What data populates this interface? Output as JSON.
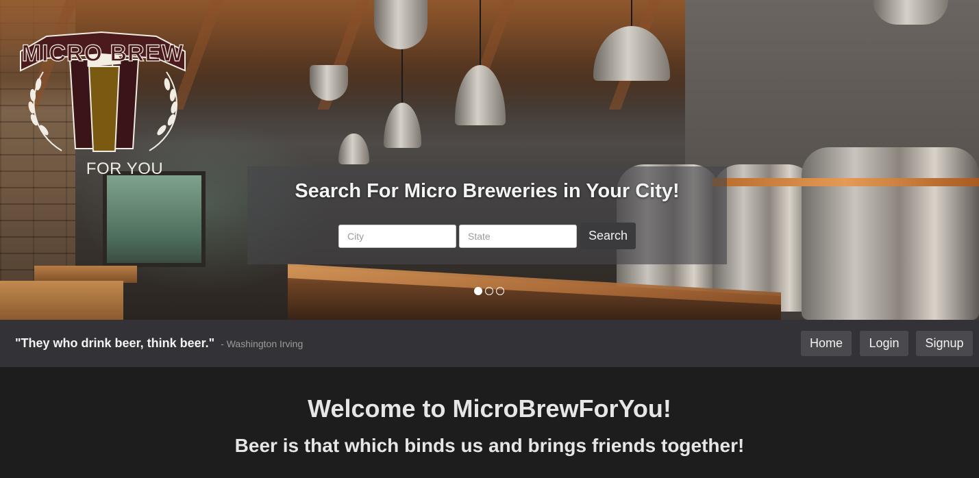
{
  "logo": {
    "main_text": "MICRO BREW",
    "sub_text": "FOR YOU"
  },
  "hero": {
    "search_title": "Search For Micro Breweries in Your City!",
    "city_placeholder": "City",
    "state_placeholder": "State",
    "search_button": "Search",
    "carousel": {
      "slides": 3,
      "active": 1
    }
  },
  "navbar": {
    "quote": "\"They who drink beer, think beer.\"",
    "quote_author": "- Washington Irving",
    "items": [
      {
        "label": "Home"
      },
      {
        "label": "Login"
      },
      {
        "label": "Signup"
      }
    ]
  },
  "welcome": {
    "title": "Welcome to MicroBrewForYou!",
    "subtitle": "Beer is that which binds us and brings friends together!"
  },
  "colors": {
    "navbar_bg": "#333236",
    "page_bg": "#1d1d1e",
    "button_bg": "#4a4a4e",
    "logo_maroon": "#4a1a1c",
    "logo_gold": "#8a6a12"
  }
}
